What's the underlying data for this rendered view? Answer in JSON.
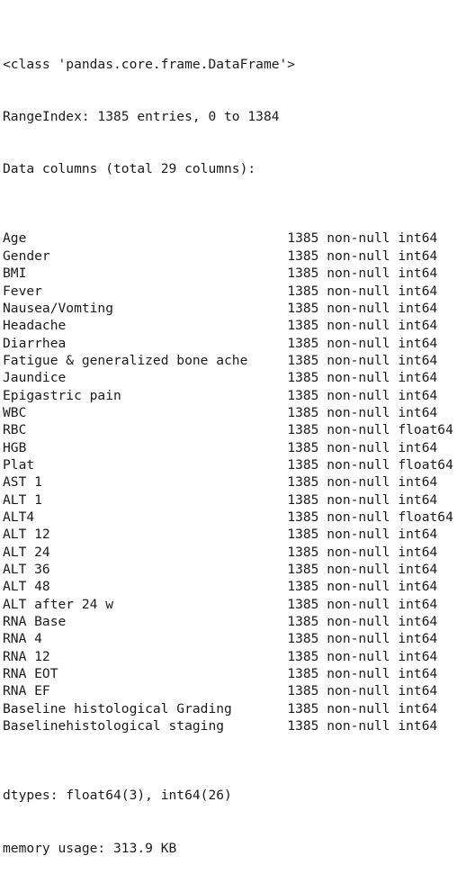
{
  "output": {
    "header_lines": [
      "<class 'pandas.core.frame.DataFrame'>",
      "RangeIndex: 1385 entries, 0 to 1384",
      "Data columns (total 29 columns):"
    ],
    "class_line": "<class 'pandas.core.frame.DataFrame'>",
    "range_index_line": "RangeIndex: 1385 entries, 0 to 1384",
    "data_columns_line": "Data columns (total 29 columns):",
    "name_column_width": 36,
    "non_null_label": "non-null",
    "columns": [
      {
        "name": "Age",
        "count": "1385",
        "null_label": "non-null",
        "dtype": "int64"
      },
      {
        "name": "Gender",
        "count": "1385",
        "null_label": "non-null",
        "dtype": "int64"
      },
      {
        "name": "BMI",
        "count": "1385",
        "null_label": "non-null",
        "dtype": "int64"
      },
      {
        "name": "Fever",
        "count": "1385",
        "null_label": "non-null",
        "dtype": "int64"
      },
      {
        "name": "Nausea/Vomting",
        "count": "1385",
        "null_label": "non-null",
        "dtype": "int64"
      },
      {
        "name": "Headache",
        "count": "1385",
        "null_label": "non-null",
        "dtype": "int64"
      },
      {
        "name": "Diarrhea",
        "count": "1385",
        "null_label": "non-null",
        "dtype": "int64"
      },
      {
        "name": "Fatigue & generalized bone ache",
        "count": "1385",
        "null_label": "non-null",
        "dtype": "int64"
      },
      {
        "name": "Jaundice",
        "count": "1385",
        "null_label": "non-null",
        "dtype": "int64"
      },
      {
        "name": "Epigastric pain",
        "count": "1385",
        "null_label": "non-null",
        "dtype": "int64"
      },
      {
        "name": "WBC",
        "count": "1385",
        "null_label": "non-null",
        "dtype": "int64"
      },
      {
        "name": "RBC",
        "count": "1385",
        "null_label": "non-null",
        "dtype": "float64"
      },
      {
        "name": "HGB",
        "count": "1385",
        "null_label": "non-null",
        "dtype": "int64"
      },
      {
        "name": "Plat",
        "count": "1385",
        "null_label": "non-null",
        "dtype": "float64"
      },
      {
        "name": "AST 1",
        "count": "1385",
        "null_label": "non-null",
        "dtype": "int64"
      },
      {
        "name": "ALT 1",
        "count": "1385",
        "null_label": "non-null",
        "dtype": "int64"
      },
      {
        "name": "ALT4",
        "count": "1385",
        "null_label": "non-null",
        "dtype": "float64"
      },
      {
        "name": "ALT 12",
        "count": "1385",
        "null_label": "non-null",
        "dtype": "int64"
      },
      {
        "name": "ALT 24",
        "count": "1385",
        "null_label": "non-null",
        "dtype": "int64"
      },
      {
        "name": "ALT 36",
        "count": "1385",
        "null_label": "non-null",
        "dtype": "int64"
      },
      {
        "name": "ALT 48",
        "count": "1385",
        "null_label": "non-null",
        "dtype": "int64"
      },
      {
        "name": "ALT after 24 w",
        "count": "1385",
        "null_label": "non-null",
        "dtype": "int64"
      },
      {
        "name": "RNA Base",
        "count": "1385",
        "null_label": "non-null",
        "dtype": "int64"
      },
      {
        "name": "RNA 4",
        "count": "1385",
        "null_label": "non-null",
        "dtype": "int64"
      },
      {
        "name": "RNA 12",
        "count": "1385",
        "null_label": "non-null",
        "dtype": "int64"
      },
      {
        "name": "RNA EOT",
        "count": "1385",
        "null_label": "non-null",
        "dtype": "int64"
      },
      {
        "name": "RNA EF",
        "count": "1385",
        "null_label": "non-null",
        "dtype": "int64"
      },
      {
        "name": "Baseline histological Grading",
        "count": "1385",
        "null_label": "non-null",
        "dtype": "int64"
      },
      {
        "name": "Baselinehistological staging",
        "count": "1385",
        "null_label": "non-null",
        "dtype": "int64"
      }
    ],
    "footer_lines": [
      "dtypes: float64(3), int64(26)",
      "memory usage: 313.9 KB"
    ],
    "dtypes_line": "dtypes: float64(3), int64(26)",
    "memory_usage_line": "memory usage: 313.9 KB"
  },
  "style": {
    "text_color": "#1b1b1b",
    "background_color": "#ffffff"
  }
}
